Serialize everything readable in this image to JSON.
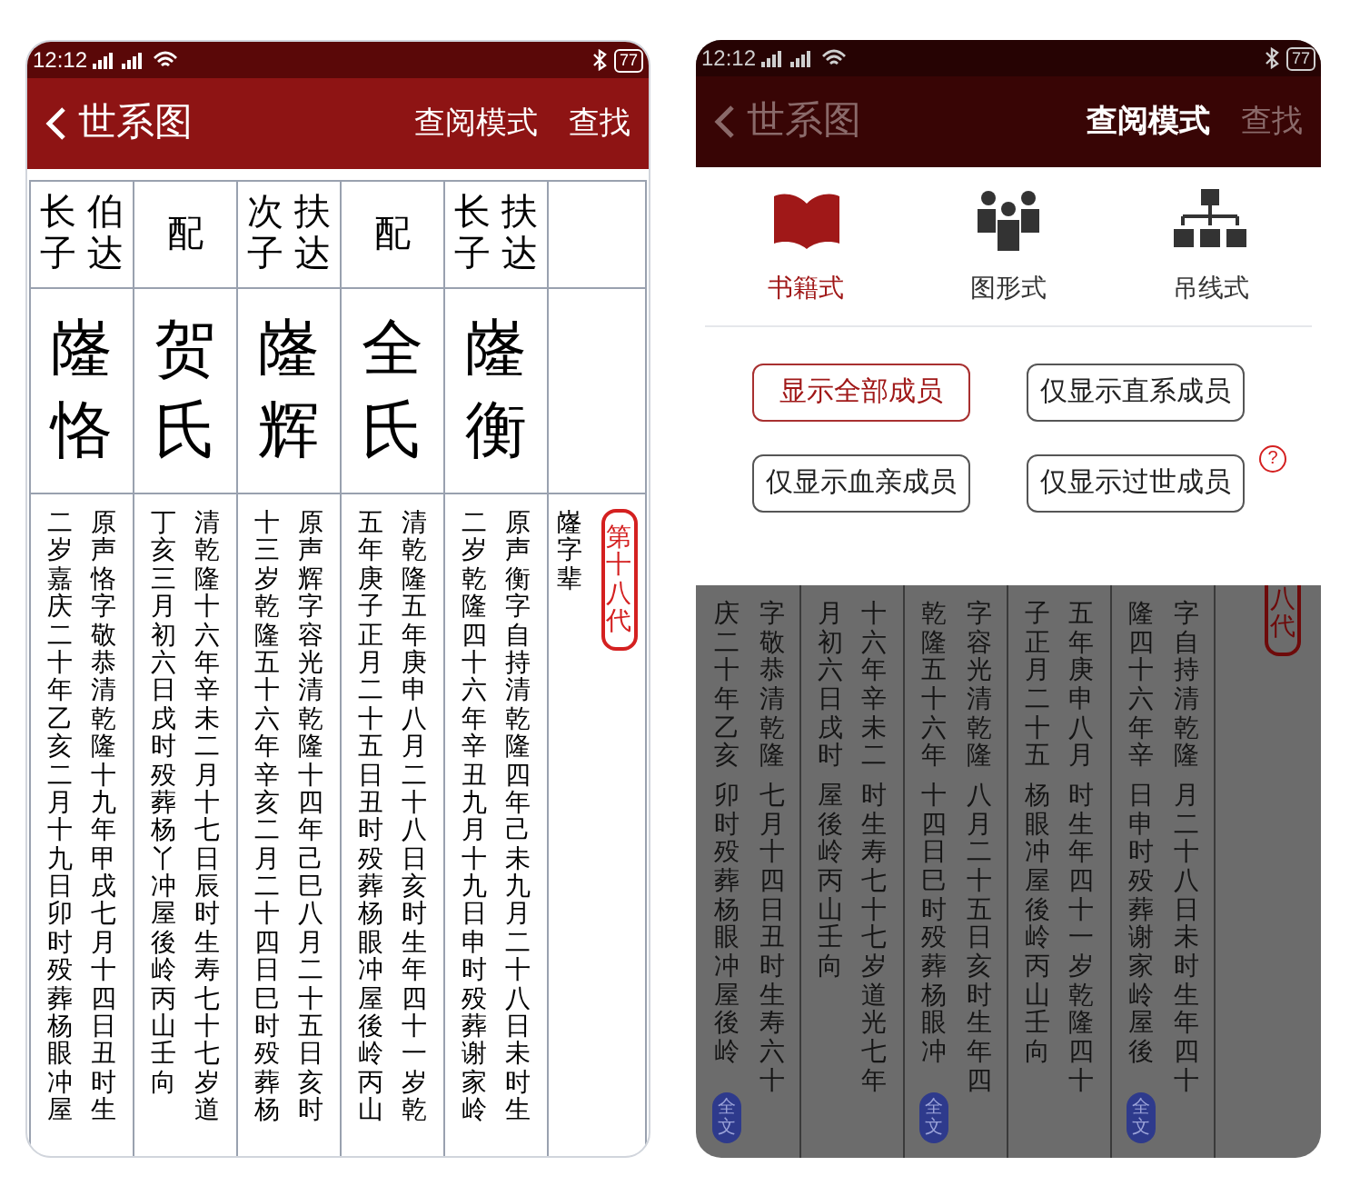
{
  "screens": [
    {
      "overlay": false,
      "status_bar": {
        "time": "12:12",
        "battery": "77"
      },
      "header": {
        "title": "世系图",
        "actions": [
          {
            "label": "查阅模式",
            "selected": false
          },
          {
            "label": "查找",
            "selected": false
          }
        ]
      },
      "table": {
        "columns": [
          {
            "relation": [
              "长子",
              "伯达"
            ],
            "name": "嶐恪",
            "bio": [
              "二岁嘉庆二十年乙亥二月十九日卯时殁葬杨眼冲屋",
              "原声恪字敬恭清乾隆十九年甲戌七月十四日丑时生"
            ]
          },
          {
            "relation": [
              "配"
            ],
            "name": "贺氏",
            "bio": [
              "丁亥三月初六日戌时殁葬杨丫冲屋後岭丙山壬向",
              "清乾隆十六年辛未二月十七日辰时生寿七十七岁道"
            ]
          },
          {
            "relation": [
              "次子",
              "扶达"
            ],
            "name": "嶐辉",
            "bio": [
              "十三岁乾隆五十六年辛亥二月二十四日巳时殁葬杨",
              "原声辉字容光清乾隆十四年己巳八月二十五日亥时"
            ]
          },
          {
            "relation": [
              "配"
            ],
            "name": "全氏",
            "bio": [
              "五年庚子正月二十五日丑时殁葬杨眼冲屋後岭丙山",
              "清乾隆五年庚申八月二十八日亥时生年四十一岁乾"
            ]
          },
          {
            "relation": [
              "长子",
              "扶达"
            ],
            "name": "嶐衡",
            "bio": [
              "二岁乾隆四十六年辛丑九月十九日申时殁葬谢家岭",
              "原声衡字自持清乾隆四年己未九月二十八日未时生"
            ]
          }
        ],
        "generation": {
          "label": "嶐字辈",
          "seal": "第十八代"
        }
      }
    },
    {
      "overlay": true,
      "status_bar": {
        "time": "12:12",
        "battery": "77"
      },
      "header": {
        "title": "世系图",
        "actions": [
          {
            "label": "查阅模式",
            "selected": true
          },
          {
            "label": "查找",
            "selected": false
          }
        ]
      },
      "menu": {
        "modes": [
          {
            "kind": "book",
            "label": "书籍式",
            "selected": true
          },
          {
            "kind": "people",
            "label": "图形式",
            "selected": false
          },
          {
            "kind": "tree",
            "label": "吊线式",
            "selected": false
          }
        ],
        "filters": [
          {
            "label": "显示全部成员",
            "selected": true
          },
          {
            "label": "仅显示直系成员",
            "selected": false
          },
          {
            "label": "仅显示血亲成员",
            "selected": false
          },
          {
            "label": "仅显示过世成员",
            "selected": false
          }
        ],
        "help": "?"
      },
      "table": {
        "columns": [
          {
            "bio": [
              [
                "庆二十年乙亥",
                "卯时殁葬杨眼冲屋後岭"
              ],
              [
                "字敬恭清乾隆",
                "七月十四日丑时生寿六十"
              ]
            ],
            "badge": "全文"
          },
          {
            "bio": [
              [
                "月初六日戌时",
                "屋後岭丙山壬向"
              ],
              [
                "十六年辛未二",
                "时生寿七十七岁道光七年"
              ]
            ]
          },
          {
            "bio": [
              [
                "乾隆五十六年",
                "十四日巳时殁葬杨眼冲"
              ],
              [
                "字容光清乾隆",
                "八月二十五日亥时生年四"
              ]
            ],
            "badge": "全文"
          },
          {
            "bio": [
              [
                "子正月二十五",
                "杨眼冲屋後岭丙山壬向"
              ],
              [
                "五年庚申八月",
                "时生年四十一岁乾隆四十"
              ]
            ]
          },
          {
            "bio": [
              [
                "隆四十六年辛",
                "日申时殁葬谢家岭屋後"
              ],
              [
                "字自持清乾隆",
                "月二十八日未时生年四十"
              ]
            ],
            "badge": "全文"
          }
        ],
        "generation": {
          "seal": "八代"
        }
      }
    }
  ]
}
